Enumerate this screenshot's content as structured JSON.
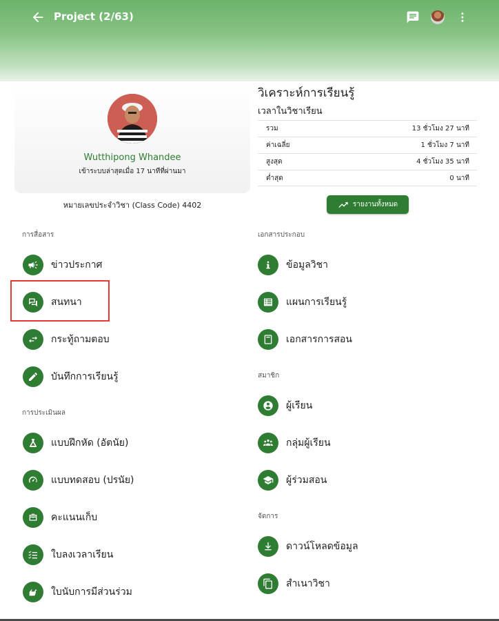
{
  "appbar": {
    "title": "Project (2/63)"
  },
  "profile": {
    "name": "Wutthipong Whandee",
    "last_login": "เข้าระบบล่าสุดเมื่อ 17 นาทีที่ผ่านมา",
    "class_code": "หมายเลขประจำวิชา (Class Code) 4402"
  },
  "analysis": {
    "title": "วิเคราะห์การเรียนรู้",
    "subtitle": "เวลาในวิชาเรียน",
    "rows": [
      {
        "label": "รวม",
        "value": "13 ชั่วโมง 27 นาที"
      },
      {
        "label": "ค่าเฉลี่ย",
        "value": "1 ชั่วโมง 7 นาที"
      },
      {
        "label": "สูงสุด",
        "value": "4 ชั่วโมง 35 นาที"
      },
      {
        "label": "ต่ำสุด",
        "value": "0 นาที"
      }
    ],
    "report_button": "รายงานทั้งหมด"
  },
  "sections": {
    "communication": "การสื่อสาร",
    "evaluation": "การประเมินผล",
    "documents": "เอกสารประกอบ",
    "members": "สมาชิก",
    "manage": "จัดการ"
  },
  "left_menu": [
    {
      "label": "ข่าวประกาศ",
      "icon": "megaphone-icon"
    },
    {
      "label": "สนทนา",
      "icon": "forum-icon"
    },
    {
      "label": "กระทู้ถามตอบ",
      "icon": "swap-arrows-icon"
    },
    {
      "label": "บันทึกการเรียนรู้",
      "icon": "pencil-icon"
    },
    {
      "label": "แบบฝึกหัด (อัตนัย)",
      "icon": "flask-icon"
    },
    {
      "label": "แบบทดสอบ (ปรนัย)",
      "icon": "speedometer-icon"
    },
    {
      "label": "คะแนนเก็บ",
      "icon": "briefcase-icon"
    },
    {
      "label": "ใบลงเวลาเรียน",
      "icon": "checklist-icon"
    },
    {
      "label": "ใบนับการมีส่วนร่วม",
      "icon": "hand-icon"
    }
  ],
  "right_menu": [
    {
      "label": "ข้อมูลวิชา",
      "icon": "info-icon"
    },
    {
      "label": "แผนการเรียนรู้",
      "icon": "table-icon"
    },
    {
      "label": "เอกสารการสอน",
      "icon": "book-icon"
    },
    {
      "label": "ผู้เรียน",
      "icon": "person-icon"
    },
    {
      "label": "กลุ่มผู้เรียน",
      "icon": "group-icon"
    },
    {
      "label": "ผู้ร่วมสอน",
      "icon": "graduation-cap-icon"
    },
    {
      "label": "ดาวน์โหลดข้อมูล",
      "icon": "download-icon"
    },
    {
      "label": "สำเนาวิชา",
      "icon": "copy-icon"
    }
  ],
  "colors": {
    "primary": "#2e7d32",
    "highlight": "#e53935"
  }
}
